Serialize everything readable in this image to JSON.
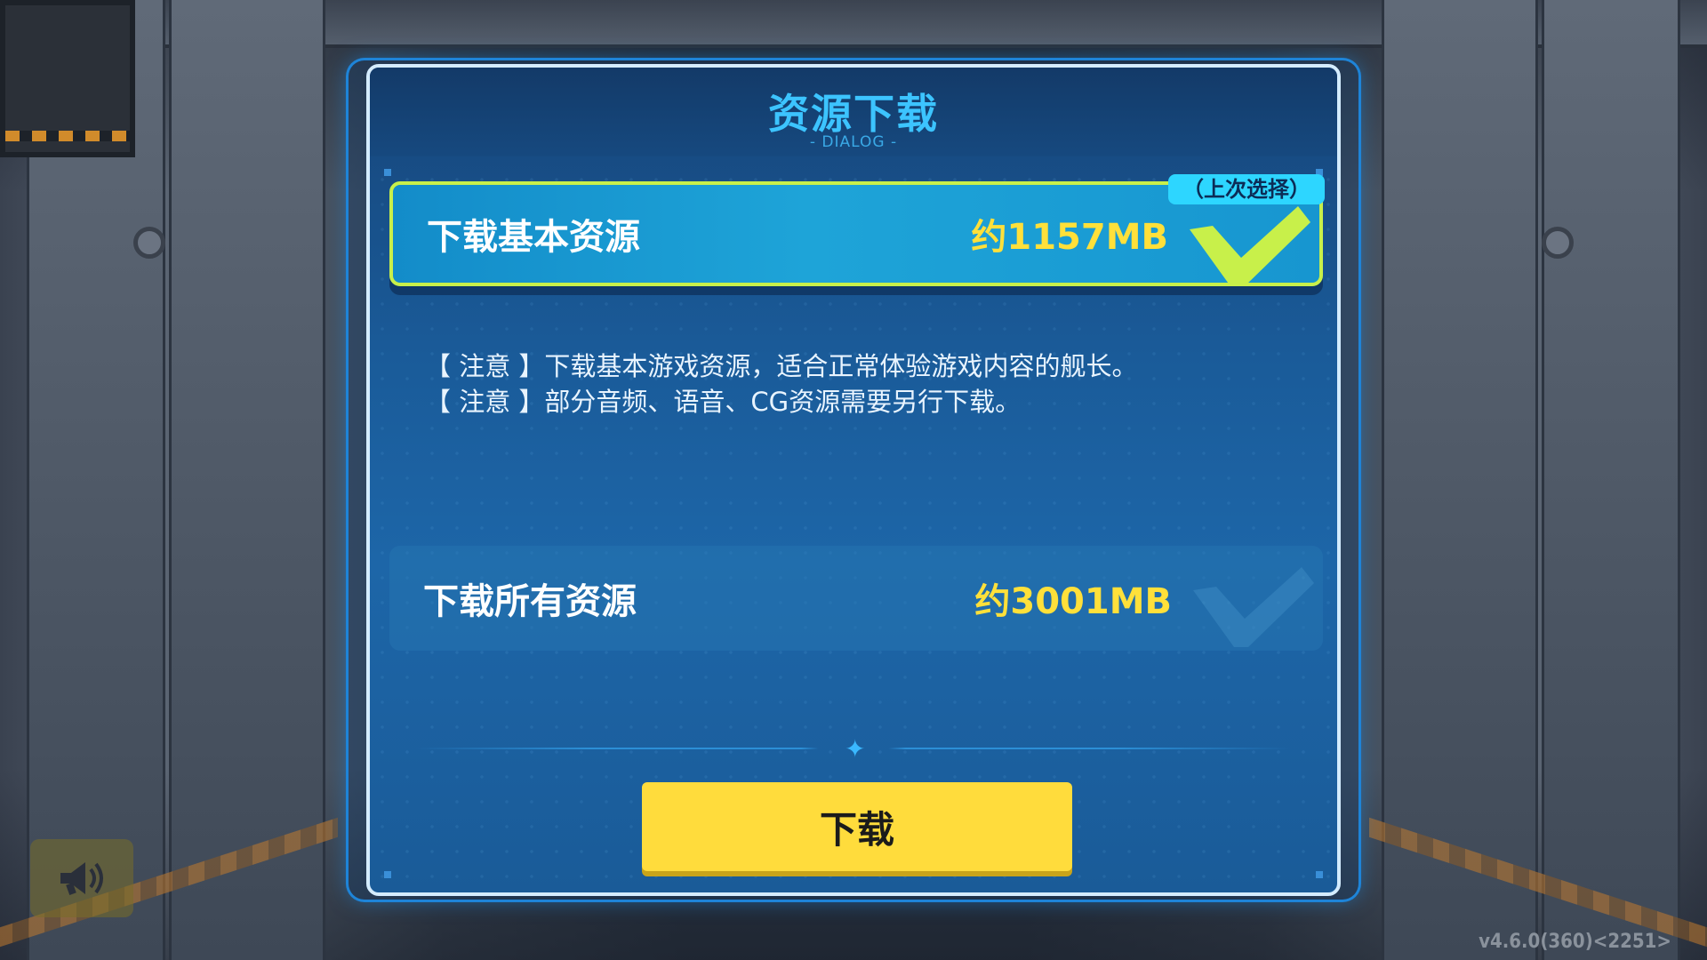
{
  "dialog": {
    "title": "资源下载",
    "subtitle": "- DIALOG -"
  },
  "options": [
    {
      "label": "下载基本资源",
      "size": "约1157MB",
      "selected": true,
      "badge": "（上次选择）"
    },
    {
      "label": "下载所有资源",
      "size": "约3001MB",
      "selected": false
    }
  ],
  "notices": [
    "【 注意 】下载基本游戏资源，适合正常体验游戏内容的舰长。",
    "【 注意 】部分音频、语音、CG资源需要另行下载。"
  ],
  "download_button": "下载",
  "speaker_icon": "megaphone-icon",
  "version": "v4.6.0(360)<2251>",
  "colors": {
    "title": "#3cc4ff",
    "size_text": "#ffe03a",
    "selected_border": "#c8f04a",
    "button": "#ffdc3c",
    "badge": "#2dd6ff"
  }
}
